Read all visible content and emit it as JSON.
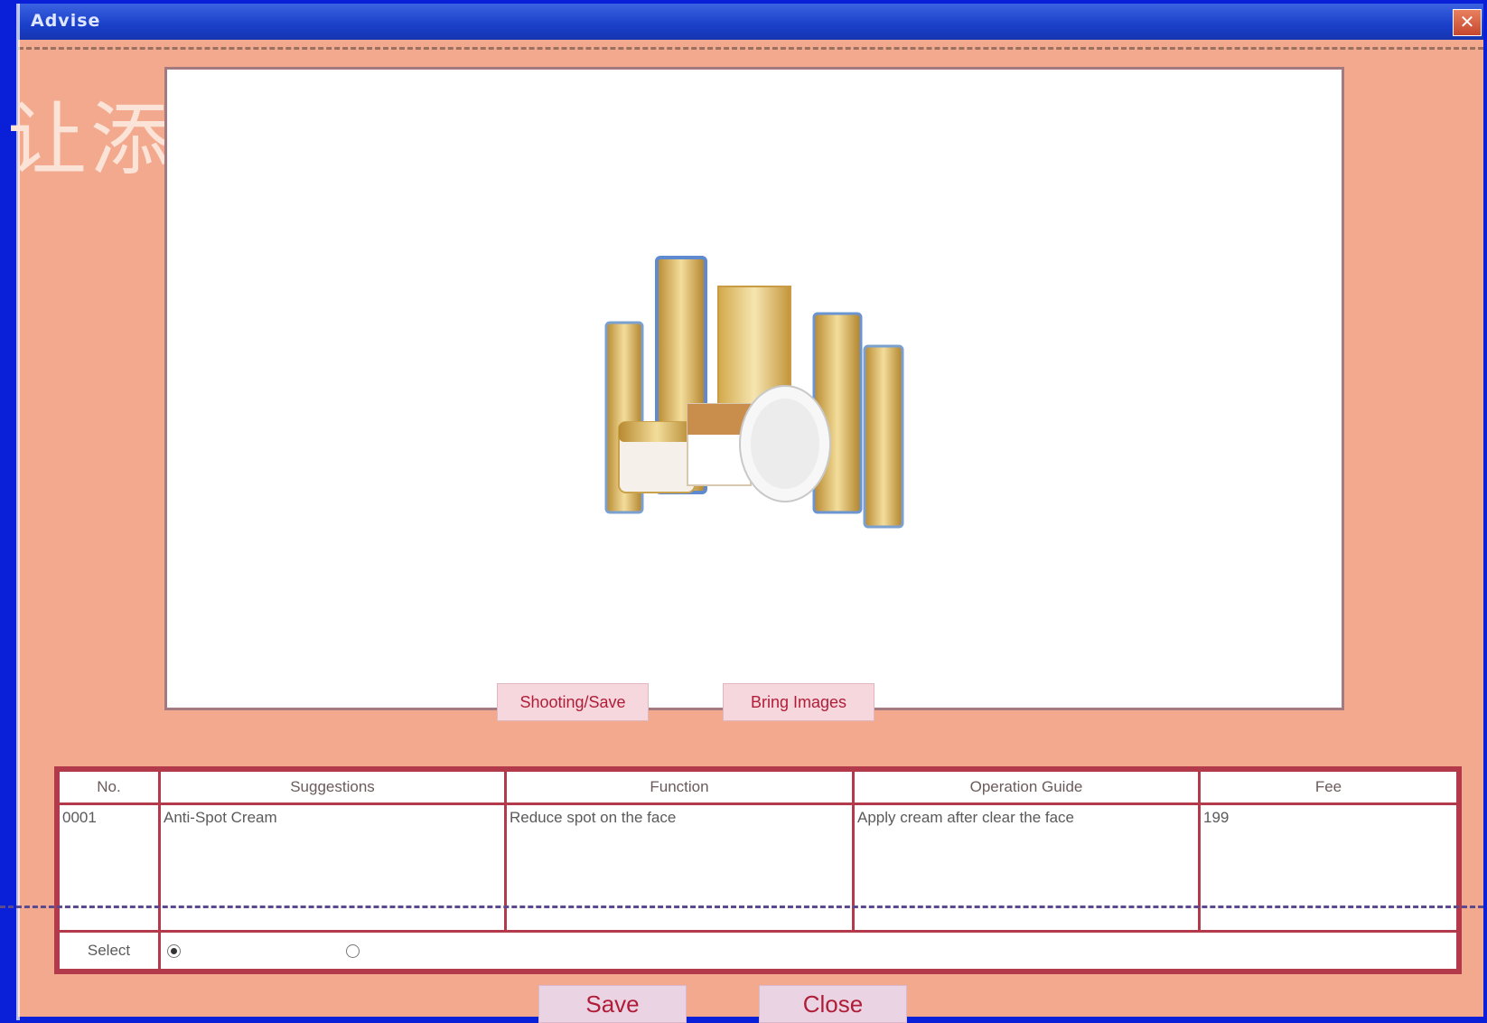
{
  "window": {
    "title": "Advise"
  },
  "watermark": "让添",
  "buttons": {
    "shooting_save": "Shooting/Save",
    "bring_images": "Bring Images",
    "save": "Save",
    "close": "Close"
  },
  "table": {
    "headers": [
      "No.",
      "Suggestions",
      "Function",
      "Operation Guide",
      "Fee"
    ],
    "rows": [
      [
        "0001",
        "Anti-Spot Cream",
        "Reduce spot on the face",
        "Apply cream after clear the face",
        "199"
      ]
    ],
    "select_label": "Select",
    "select_options": [
      {
        "checked": true
      },
      {
        "checked": false
      }
    ]
  },
  "colors": {
    "window_bg": "#f2a98d",
    "titlebar": "#1a3fc9",
    "table_border": "#b23a4b",
    "button_text": "#b01d38"
  },
  "icons": {
    "close": "close-icon",
    "product": "product-image"
  }
}
